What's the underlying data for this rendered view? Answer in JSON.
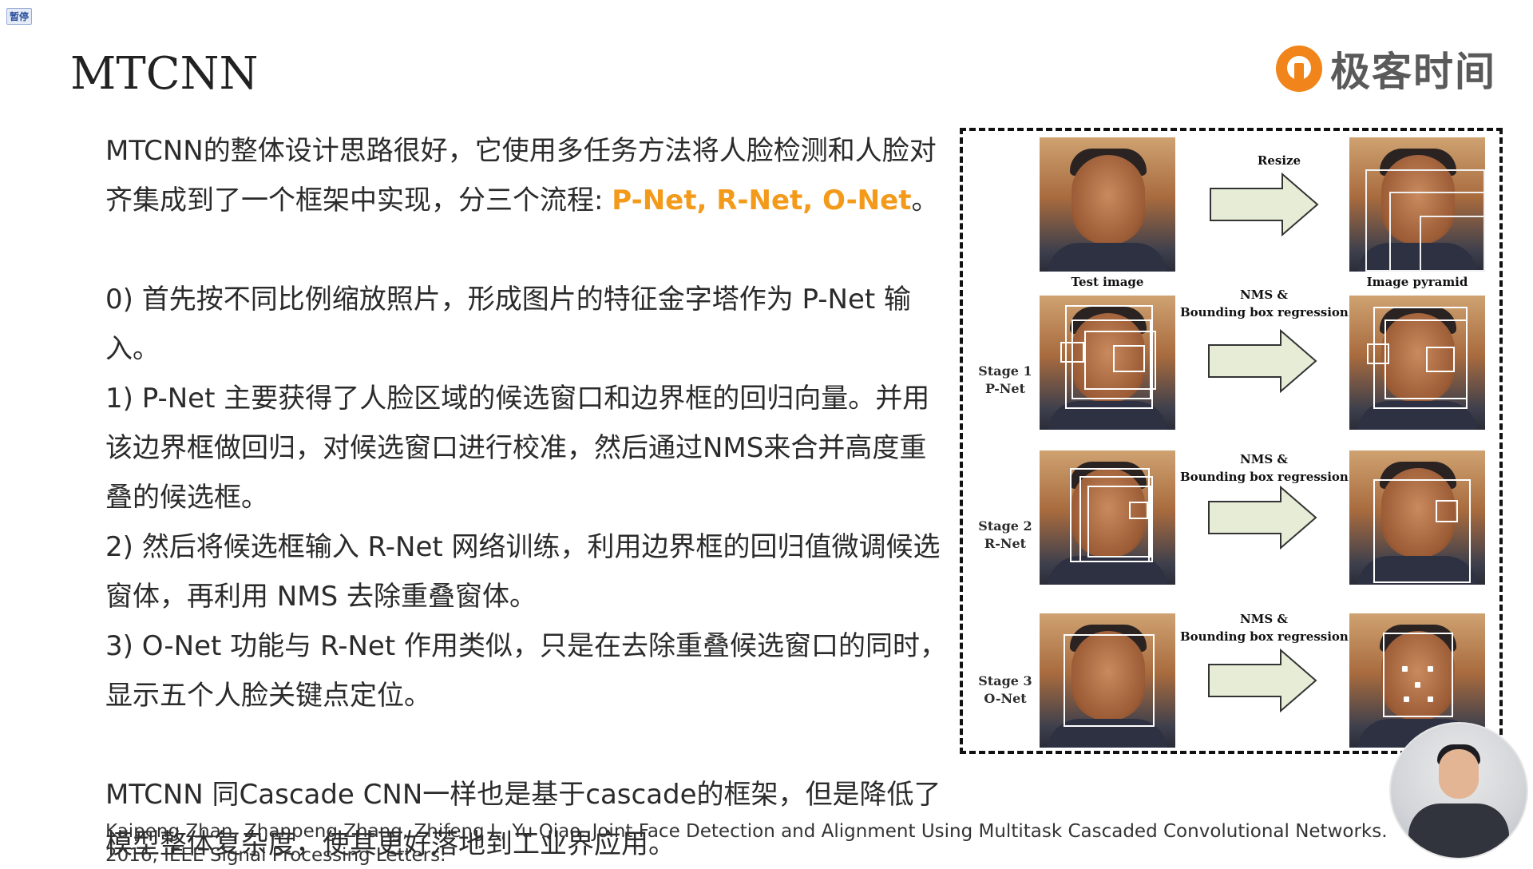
{
  "pause_badge": "暂停",
  "title": "MTCNN",
  "logo": {
    "text": "极客时间",
    "icon": "geektime-logo-icon",
    "color": "#f1841a"
  },
  "highlight_color": "#f39a1a",
  "paragraphs": {
    "intro_a": "MTCNN的整体设计思路很好，它使用多任务方法将人脸检测和人脸对齐集成到了一个框架中实现，分三个流程: ",
    "intro_highlight": "P-Net, R-Net, O-Net",
    "intro_b": "。",
    "step0": "0) 首先按不同比例缩放照片，形成图片的特征金字塔作为 P-Net 输入。",
    "step1": "1) P-Net 主要获得了人脸区域的候选窗口和边界框的回归向量。并用该边界框做回归，对候选窗口进行校准，然后通过NMS来合并高度重叠的候选框。",
    "step2": "2) 然后将候选框输入 R-Net 网络训练，利用边界框的回归值微调候选窗体，再利用 NMS 去除重叠窗体。",
    "step3": "3) O-Net 功能与 R-Net 作用类似，只是在去除重叠候选窗口的同时，显示五个人脸关键点定位。",
    "conclusion": "MTCNN 同Cascade CNN一样也是基于cascade的框架，但是降低了模型整体复杂度，使其更好落地到工业界应用。"
  },
  "reference": "Kaipeng Zhan, Zhanpeng Zhang, Zhifeng L, Yu Qiao. Joint Face Detection and Alignment Using Multitask Cascaded Convolutional Networks. 2016, IEEE Signal Processing Letters.",
  "figure": {
    "resize_label": "Resize",
    "test_image_label": "Test image",
    "pyramid_label": "Image pyramid",
    "nms_line1": "NMS &",
    "nms_line2": "Bounding box regression",
    "stage1_a": "Stage 1",
    "stage1_b": "P-Net",
    "stage2_a": "Stage 2",
    "stage2_b": "R-Net",
    "stage3_a": "Stage 3",
    "stage3_b": "O-Net"
  }
}
